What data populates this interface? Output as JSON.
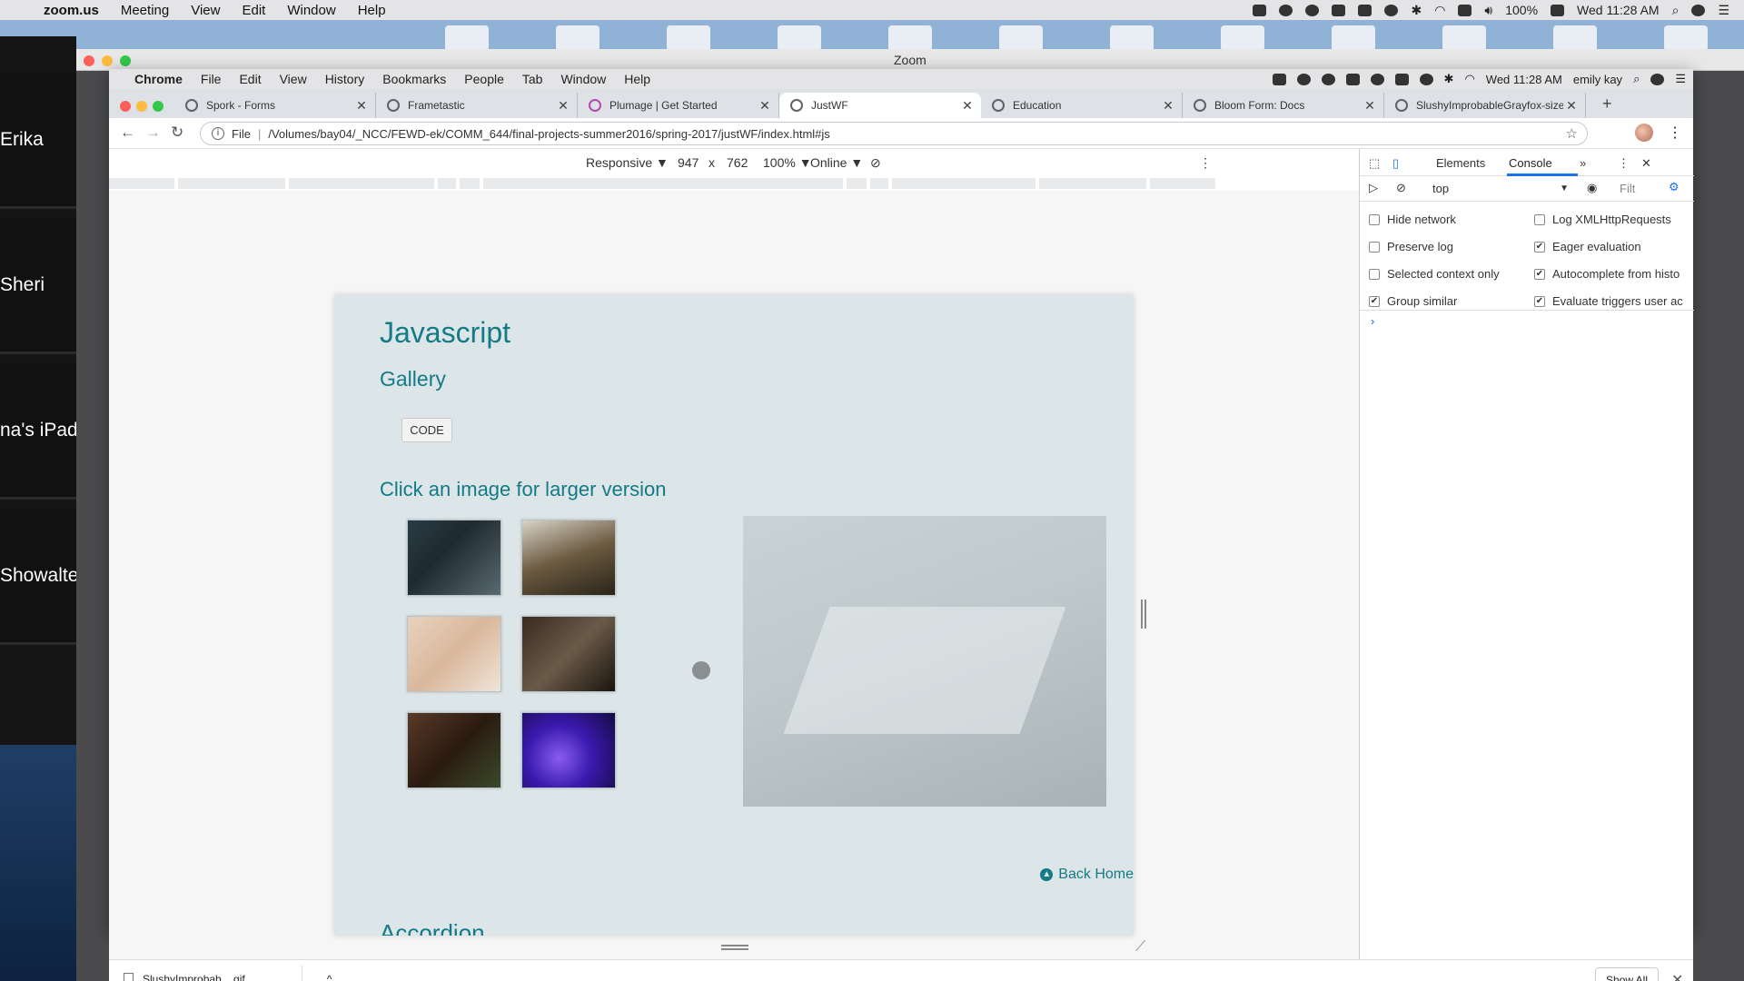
{
  "mac_menubar": {
    "app": "zoom.us",
    "items": [
      "Meeting",
      "View",
      "Edit",
      "Window",
      "Help"
    ],
    "battery": "100%",
    "clock": "Wed 11:28 AM"
  },
  "zoom": {
    "window_title": "Zoom",
    "participants": [
      "Erika",
      "Sheri",
      "na's iPad",
      "Showalte"
    ]
  },
  "chrome_menubar": {
    "app": "Chrome",
    "items": [
      "File",
      "Edit",
      "View",
      "History",
      "Bookmarks",
      "People",
      "Tab",
      "Window",
      "Help"
    ],
    "clock": "Wed 11:28 AM",
    "user": "emily kay"
  },
  "tabs": [
    {
      "label": "Spork - Forms",
      "active": false
    },
    {
      "label": "Frametastic",
      "active": false
    },
    {
      "label": "Plumage | Get Started",
      "active": false
    },
    {
      "label": "JustWF",
      "active": true
    },
    {
      "label": "Education",
      "active": false
    },
    {
      "label": "Bloom Form: Docs",
      "active": false
    },
    {
      "label": "SlushyImprobableGrayfox-size",
      "active": false
    }
  ],
  "omnibox": {
    "scheme": "File",
    "url": "/Volumes/bay04/_NCC/FEWD-ek/COMM_644/final-projects-summer2016/spring-2017/justWF/index.html#js"
  },
  "device_toolbar": {
    "mode": "Responsive ▼",
    "width": "947",
    "times": "x",
    "height": "762",
    "zoom": "100% ▼",
    "network": "Online ▼"
  },
  "page": {
    "heading": "Javascript",
    "subheading": "Gallery",
    "code_button": "CODE",
    "click_hint": "Click an image for larger version",
    "back_home": "Back Home",
    "next_section": "Accordion"
  },
  "devtools": {
    "tabs": [
      "Elements",
      "Console",
      "»"
    ],
    "active_tab": "Console",
    "context": "top",
    "filter_placeholder": "Filt",
    "options": [
      {
        "label": "Hide network",
        "checked": false
      },
      {
        "label": "Log XMLHttpRequests",
        "checked": false
      },
      {
        "label": "Preserve log",
        "checked": false
      },
      {
        "label": "Eager evaluation",
        "checked": true
      },
      {
        "label": "Selected context only",
        "checked": false
      },
      {
        "label": "Autocomplete from histo",
        "checked": true
      },
      {
        "label": "Group similar",
        "checked": true
      },
      {
        "label": "Evaluate triggers user ac",
        "checked": true
      }
    ],
    "prompt": "›"
  },
  "downloads": {
    "file": "SlushyImprobab....gif",
    "show_all": "Show All"
  }
}
